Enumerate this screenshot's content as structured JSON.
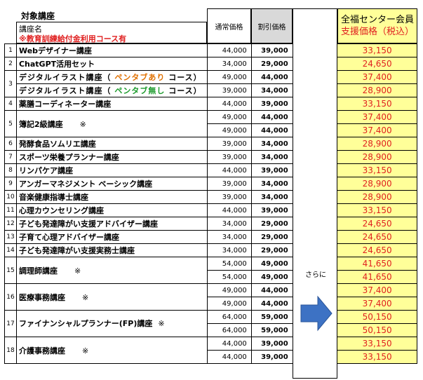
{
  "header": {
    "title": "対象講座",
    "course_label": "講座名",
    "note": "※教育訓練給付金利用コース有",
    "normal_price": "通常価格",
    "discount_price": "割引価格",
    "center_l1": "全福センター会員",
    "center_l2": "支援価格（税込）"
  },
  "mid_label": "さらに",
  "rows": [
    {
      "no": "1",
      "name": "Webデザイナー講座",
      "mark": "",
      "normal": "44,000",
      "disc": "39,000",
      "center": "33,150"
    },
    {
      "no": "2",
      "name": "ChatGPT活用セット",
      "mark": "",
      "normal": "34,000",
      "disc": "29,000",
      "center": "24,650"
    },
    {
      "no": "3",
      "name_a": "デジタルイラスト講座（",
      "name_b": "ペンタブあり",
      "name_c": "コース）",
      "mark": "",
      "normal": "49,000",
      "disc": "44,000",
      "center": "37,400"
    },
    {
      "no": "",
      "name_a": "デジタルイラスト講座（",
      "name_b": "ペンタブ無し",
      "name_c": "コース）",
      "mark": "",
      "normal": "39,000",
      "disc": "34,000",
      "center": "28,900"
    },
    {
      "no": "4",
      "name": "薬膳コーディネーター講座",
      "mark": "",
      "normal": "44,000",
      "disc": "39,000",
      "center": "33,150"
    },
    {
      "no": "5",
      "name": "簿記2級講座",
      "mark": "※",
      "normal": "49,000",
      "disc": "44,000",
      "center": "37,400"
    },
    {
      "no": "",
      "name": "",
      "mark": "",
      "normal": "49,000",
      "disc": "44,000",
      "center": "37,400"
    },
    {
      "no": "6",
      "name": "発酵食品ソムリエ講座",
      "mark": "",
      "normal": "39,000",
      "disc": "34,000",
      "center": "28,900"
    },
    {
      "no": "7",
      "name": "スポーツ栄養プランナー講座",
      "mark": "",
      "normal": "39,000",
      "disc": "34,000",
      "center": "28,900"
    },
    {
      "no": "8",
      "name": "リンパケア講座",
      "mark": "",
      "normal": "44,000",
      "disc": "39,000",
      "center": "33,150"
    },
    {
      "no": "9",
      "name": "アンガーマネジメント ベーシック講座",
      "mark": "",
      "normal": "39,000",
      "disc": "34,000",
      "center": "28,900"
    },
    {
      "no": "10",
      "name": "音楽健康指導士講座",
      "mark": "",
      "normal": "39,000",
      "disc": "34,000",
      "center": "28,900"
    },
    {
      "no": "11",
      "name": "心理カウンセリング講座",
      "mark": "",
      "normal": "44,000",
      "disc": "39,000",
      "center": "33,150"
    },
    {
      "no": "12",
      "name": "子ども発達障がい支援アドバイザー講座",
      "mark": "",
      "normal": "34,000",
      "disc": "29,000",
      "center": "24,650"
    },
    {
      "no": "13",
      "name": "子育て心理アドバイザー講座",
      "mark": "",
      "normal": "34,000",
      "disc": "29,000",
      "center": "24,650"
    },
    {
      "no": "14",
      "name": "子ども発達障がい支援実務士講座",
      "mark": "",
      "normal": "34,000",
      "disc": "29,000",
      "center": "24,650"
    },
    {
      "no": "15",
      "name": "調理師講座",
      "mark": "※",
      "normal": "54,000",
      "disc": "49,000",
      "center": "41,650"
    },
    {
      "no": "",
      "name": "",
      "mark": "",
      "normal": "54,000",
      "disc": "49,000",
      "center": "41,650"
    },
    {
      "no": "16",
      "name": "医療事務講座",
      "mark": "※",
      "normal": "49,000",
      "disc": "44,000",
      "center": "37,400"
    },
    {
      "no": "",
      "name": "",
      "mark": "",
      "normal": "49,000",
      "disc": "44,000",
      "center": "37,400"
    },
    {
      "no": "17",
      "name": "ファイナンシャルプランナー(FP)講座",
      "mark": "※",
      "normal": "64,000",
      "disc": "59,000",
      "center": "50,150"
    },
    {
      "no": "",
      "name": "",
      "mark": "",
      "normal": "64,000",
      "disc": "59,000",
      "center": "50,150"
    },
    {
      "no": "18",
      "name": "介護事務講座",
      "mark": "※",
      "normal": "44,000",
      "disc": "39,000",
      "center": "33,150"
    },
    {
      "no": "",
      "name": "",
      "mark": "",
      "normal": "44,000",
      "disc": "39,000",
      "center": "33,150"
    }
  ],
  "colors": {
    "accent_red": "#e02020",
    "highlight": "#ffff99",
    "arrow": "#3d72c4",
    "gray": "#d9d9d9"
  }
}
